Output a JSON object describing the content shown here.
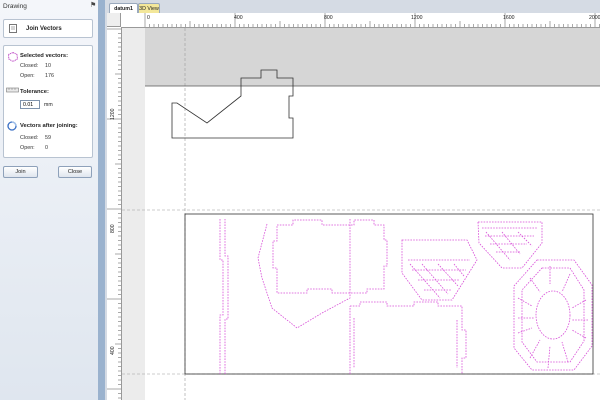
{
  "panel": {
    "title": "Drawing",
    "pin_icon": "pin-icon",
    "tool_title": "Join Vectors",
    "selected": {
      "title": "Selected vectors:",
      "closed_label": "Closed:",
      "closed_value": "10",
      "open_label": "Open:",
      "open_value": "176"
    },
    "tolerance": {
      "title": "Tolerance:",
      "value": "0.01",
      "unit": "mm"
    },
    "after": {
      "title": "Vectors after joining:",
      "closed_label": "Closed:",
      "closed_value": "59",
      "open_label": "Open:",
      "open_value": "0"
    },
    "join_label": "Join",
    "close_label": "Close"
  },
  "tabs": [
    {
      "label": "datum1",
      "active": true
    },
    {
      "label": "3D View",
      "active": false
    }
  ],
  "rulers": {
    "top_labels": [
      "0",
      "400",
      "800",
      "1200",
      "1600",
      "2000"
    ],
    "left_labels": [
      "1200",
      "800",
      "400"
    ]
  },
  "colors": {
    "accent_pink": "#d84fd8",
    "outline": "#333333",
    "panel_bg": "#dfe6ef"
  }
}
